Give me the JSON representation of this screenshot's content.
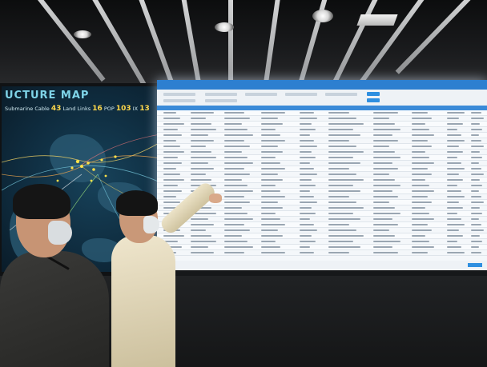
{
  "map_panel": {
    "title": "UCTURE MAP",
    "legend": [
      {
        "label": "Submarine Cable",
        "value": "43"
      },
      {
        "label": "Land Links",
        "value": "16"
      },
      {
        "label": "POP",
        "value": "103"
      },
      {
        "label": "IX",
        "value": "13"
      }
    ]
  },
  "colors": {
    "screen_header": "#2d7fd0",
    "map_accent": "#7fd4e8",
    "legend_value": "#ffd84a"
  }
}
